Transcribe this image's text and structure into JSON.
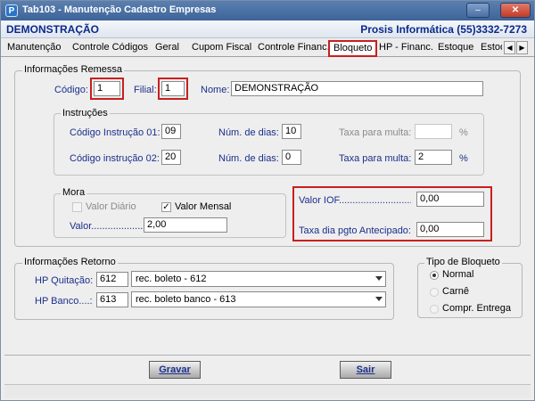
{
  "window": {
    "title": "Tab103 - Manutenção Cadastro Empresas",
    "icon_letter": "P",
    "controls": {
      "minimize": "–",
      "maximize": "□",
      "close": "✕"
    }
  },
  "header": {
    "company": "DEMONSTRAÇÃO",
    "vendor": "Prosis Informática (55)3332-7273"
  },
  "tabs": [
    "Manutenção",
    "Controle Códigos",
    "Geral",
    "Cupom Fiscal",
    "Controle Financ.",
    "Bloqueto",
    "HP - Financ.",
    "Estoque",
    "Estoq"
  ],
  "active_tab": "Bloqueto",
  "remessa": {
    "legend": "Informações Remessa",
    "codigo_label": "Código:",
    "codigo_value": "1",
    "filial_label": "Filial:",
    "filial_value": "1",
    "nome_label": "Nome:",
    "nome_value": "DEMONSTRAÇÃO"
  },
  "instrucoes": {
    "legend": "Instruções",
    "row1": {
      "label": "Código Instrução 01:",
      "value": "09",
      "dias_label": "Núm. de dias:",
      "dias_value": "10",
      "taxa_label": "Taxa para multa:",
      "taxa_value": "",
      "pct": "%"
    },
    "row2": {
      "label": "Código instrução 02:",
      "value": "20",
      "dias_label": "Núm. de dias:",
      "dias_value": "0",
      "taxa_label": "Taxa para multa:",
      "taxa_value": "2",
      "pct": "%"
    }
  },
  "mora": {
    "legend": "Mora",
    "valor_diario_label": "Valor Diário",
    "valor_diario_checked": false,
    "valor_mensal_label": "Valor Mensal",
    "valor_mensal_checked": true,
    "valor_label": "Valor.....................:",
    "valor_value": "2,00"
  },
  "iof": {
    "valor_iof_label": "Valor IOF..............................:",
    "valor_iof_value": "0,00",
    "taxa_label": "Taxa dia pgto Antecipado:",
    "taxa_value": "0,00"
  },
  "retorno": {
    "legend": "Informações Retorno",
    "quitacao_label": "HP Quitação:",
    "quitacao_code": "612",
    "quitacao_select": "rec. boleto  - 612",
    "banco_label": "HP Banco....:",
    "banco_code": "613",
    "banco_select": "rec. boleto banco - 613"
  },
  "tipo": {
    "legend": "Tipo de Bloqueto",
    "options": [
      "Normal",
      "Carnê",
      "Compr. Entrega"
    ],
    "selected": "Normal"
  },
  "buttons": {
    "gravar": "Gravar",
    "sair": "Sair"
  }
}
